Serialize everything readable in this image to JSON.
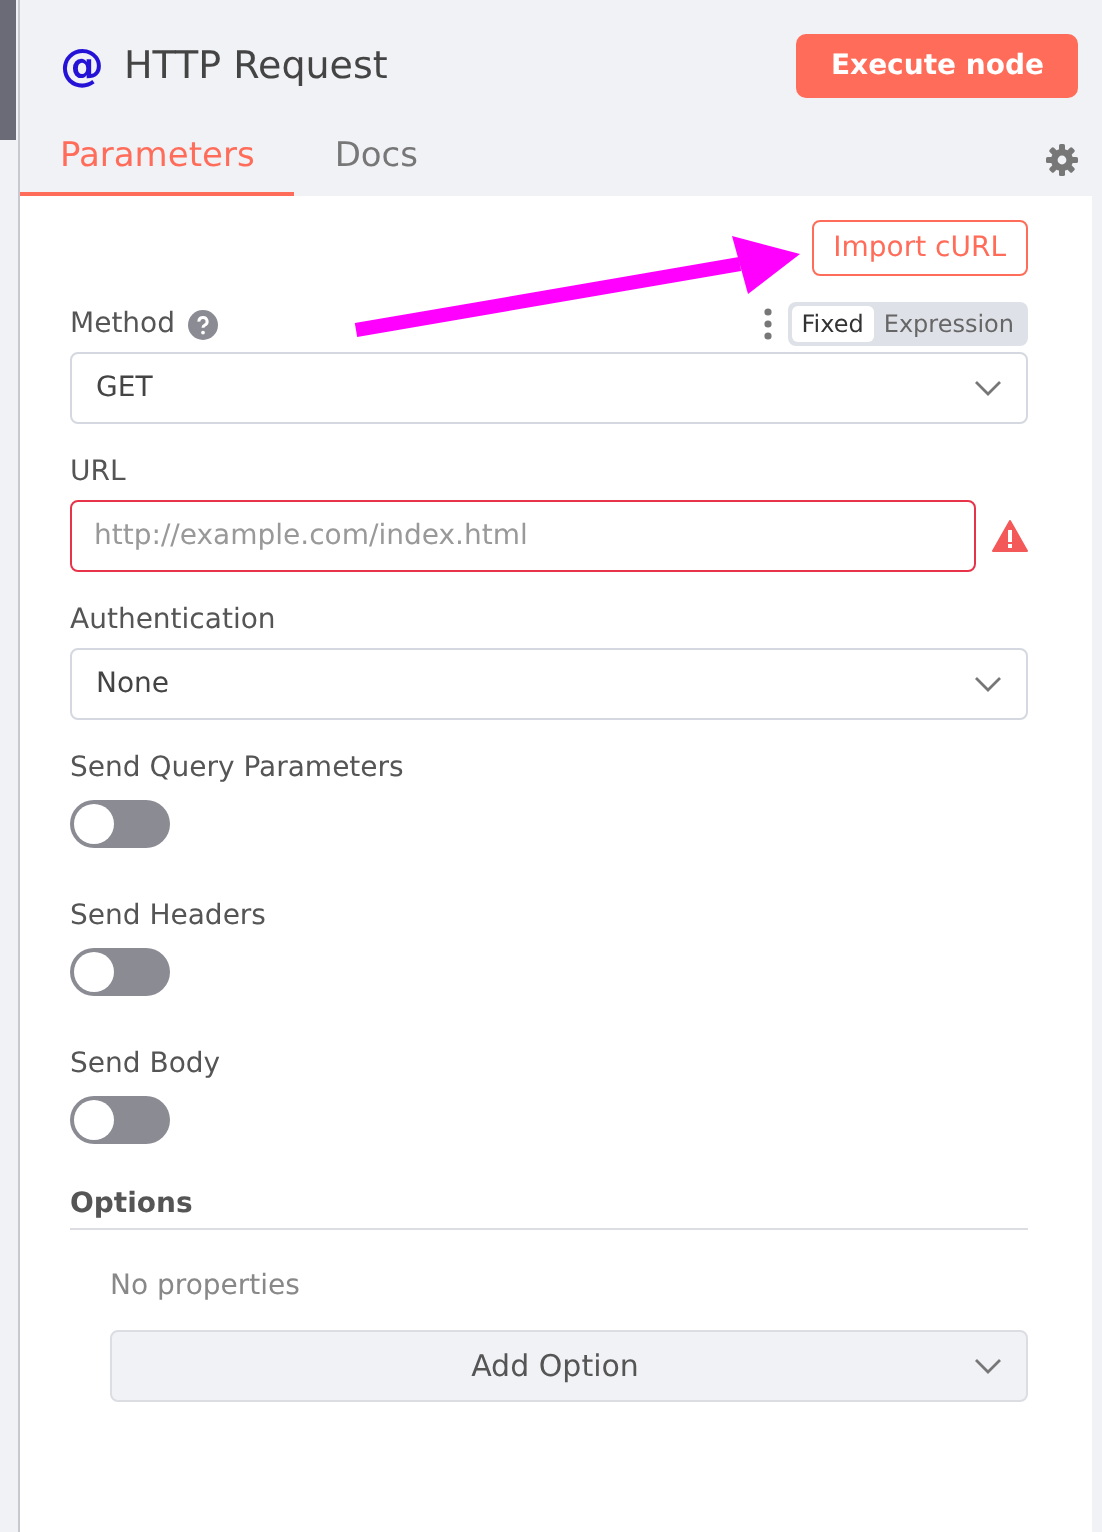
{
  "header": {
    "icon": "@",
    "title": "HTTP Request",
    "execute_button": "Execute node"
  },
  "tabs": [
    {
      "label": "Parameters",
      "selected": true
    },
    {
      "label": "Docs",
      "selected": false
    }
  ],
  "import_button": "Import cURL",
  "fields": [
    {
      "kind": "select",
      "label": "Method",
      "help": true,
      "mode_toggle": [
        {
          "label": "Fixed",
          "selected": true
        },
        {
          "label": "Expression",
          "selected": false
        }
      ],
      "value": "GET"
    },
    {
      "kind": "input",
      "label": "URL",
      "placeholder": "http://example.com/index.html",
      "error": true
    },
    {
      "kind": "select",
      "label": "Authentication",
      "value": "None"
    },
    {
      "kind": "toggle",
      "label": "Send Query Parameters",
      "on": false
    },
    {
      "kind": "toggle",
      "label": "Send Headers",
      "on": false
    },
    {
      "kind": "toggle",
      "label": "Send Body",
      "on": false
    }
  ],
  "options": {
    "title": "Options",
    "empty_text": "No properties",
    "add_button": "Add Option"
  }
}
